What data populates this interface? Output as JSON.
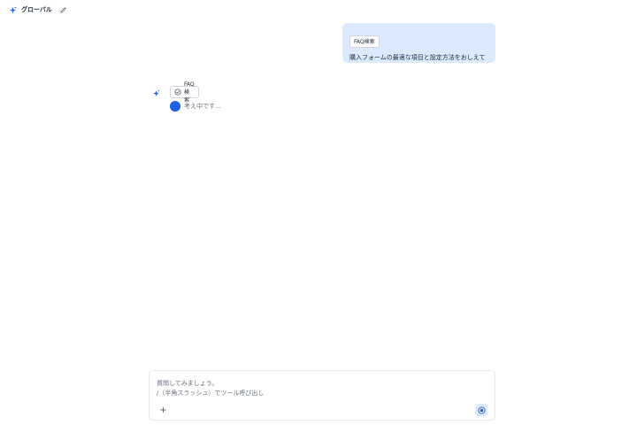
{
  "header": {
    "title": "グローバル",
    "logo_icon": "sparkle-icon",
    "edit_icon": "pencil-icon"
  },
  "user_message": {
    "tool_label": "FAQ検索",
    "text": "購入フォームの最適な項目と設定方法をおしえて"
  },
  "assistant": {
    "avatar_icon": "sparkle-icon",
    "tool_label": "FAQ検索",
    "tool_icon": "check-circle-icon",
    "status_text": "考え中です…"
  },
  "composer": {
    "placeholder_line1": "質問してみましょう。",
    "placeholder_line2": "/（半角スラッシュ）でツール呼び出し",
    "add_label": "+",
    "add_icon": "plus-icon",
    "send_icon": "stop-icon"
  },
  "colors": {
    "accent": "#1d5fef",
    "bubble_bg": "#dbeafe",
    "text": "#1f2937",
    "muted": "#6b7280"
  }
}
